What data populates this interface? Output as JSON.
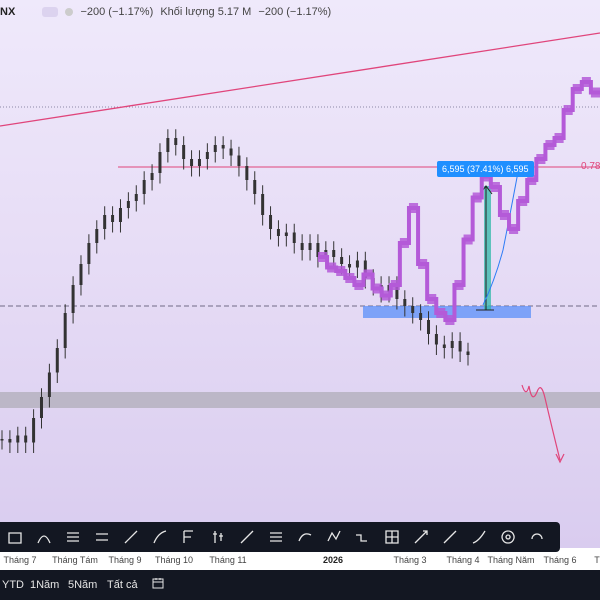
{
  "header": {
    "symbol_tail": "NX",
    "change_text": "−200 (−1.17%)",
    "volume_label": "Khối lượng",
    "volume_value": "5.17 M",
    "volume_change": "−200 (−1.17%)"
  },
  "measure": {
    "label": "6,595 (37.41%) 6,595",
    "fill_color": "#1f8fff"
  },
  "fib_label": "0.78",
  "colors": {
    "background_top": "#efe9fb",
    "background_bottom": "#d9ccef",
    "candles": "#333333",
    "projection": "#b45ad8",
    "trendline": "#e0457b",
    "support_zone": "#5b8ff9",
    "gray_zone": "#b8b4c2",
    "dark_bar": "#131722"
  },
  "chart_data": {
    "type": "candlestick",
    "title": "",
    "xlabel": "",
    "ylabel": "",
    "x_ticks": [
      "Tháng 7",
      "Tháng Tám",
      "Tháng 9",
      "Tháng 10",
      "Tháng 11",
      "2026",
      "Tháng 3",
      "Tháng 4",
      "Tháng Năm",
      "Tháng 6",
      "T"
    ],
    "price_levels": {
      "lower": 0,
      "upper": 1
    },
    "series": [
      {
        "kind": "historical_candles",
        "close_norm": [
          0.06,
          0.05,
          0.07,
          0.05,
          0.12,
          0.18,
          0.25,
          0.32,
          0.42,
          0.5,
          0.56,
          0.62,
          0.66,
          0.7,
          0.68,
          0.72,
          0.74,
          0.76,
          0.8,
          0.82,
          0.88,
          0.92,
          0.9,
          0.86,
          0.84,
          0.86,
          0.88,
          0.9,
          0.89,
          0.87,
          0.84,
          0.8,
          0.76,
          0.7,
          0.66,
          0.64,
          0.65,
          0.62,
          0.6,
          0.62,
          0.58,
          0.6,
          0.58,
          0.56,
          0.55,
          0.57,
          0.52,
          0.5,
          0.48,
          0.5,
          0.46,
          0.44,
          0.42,
          0.4,
          0.36,
          0.33,
          0.32,
          0.34,
          0.31,
          0.3
        ]
      },
      {
        "kind": "projection_bars",
        "close_norm": [
          0.58,
          0.55,
          0.54,
          0.52,
          0.5,
          0.53,
          0.49,
          0.47,
          0.5,
          0.62,
          0.72,
          0.56,
          0.46,
          0.42,
          0.4,
          0.5,
          0.63,
          0.75,
          0.81,
          0.78,
          0.7,
          0.66,
          0.74,
          0.8,
          0.86,
          0.9,
          0.92,
          1.0,
          1.06,
          1.08,
          1.05
        ]
      }
    ],
    "annotations": [
      "6,595 (37.41%) 6,595",
      "0.78"
    ],
    "grid": false,
    "legend": "none"
  },
  "toolbar": {
    "tools": [
      "rectangle-tool",
      "curve-tool",
      "pitchfork-tool",
      "channel-tool",
      "brush-tool",
      "path-tool",
      "fib-tool",
      "candle-tool",
      "segment-tool",
      "lines-tool",
      "forecast-tool",
      "pattern-tool",
      "elliott-tool",
      "long-position-tool",
      "measure-tool",
      "arrow-tool",
      "brush2-tool",
      "eye-tool",
      "magnet-tool"
    ]
  },
  "bottom": {
    "ranges": [
      "YTD",
      "1Năm",
      "5Năm",
      "Tất cả"
    ]
  }
}
